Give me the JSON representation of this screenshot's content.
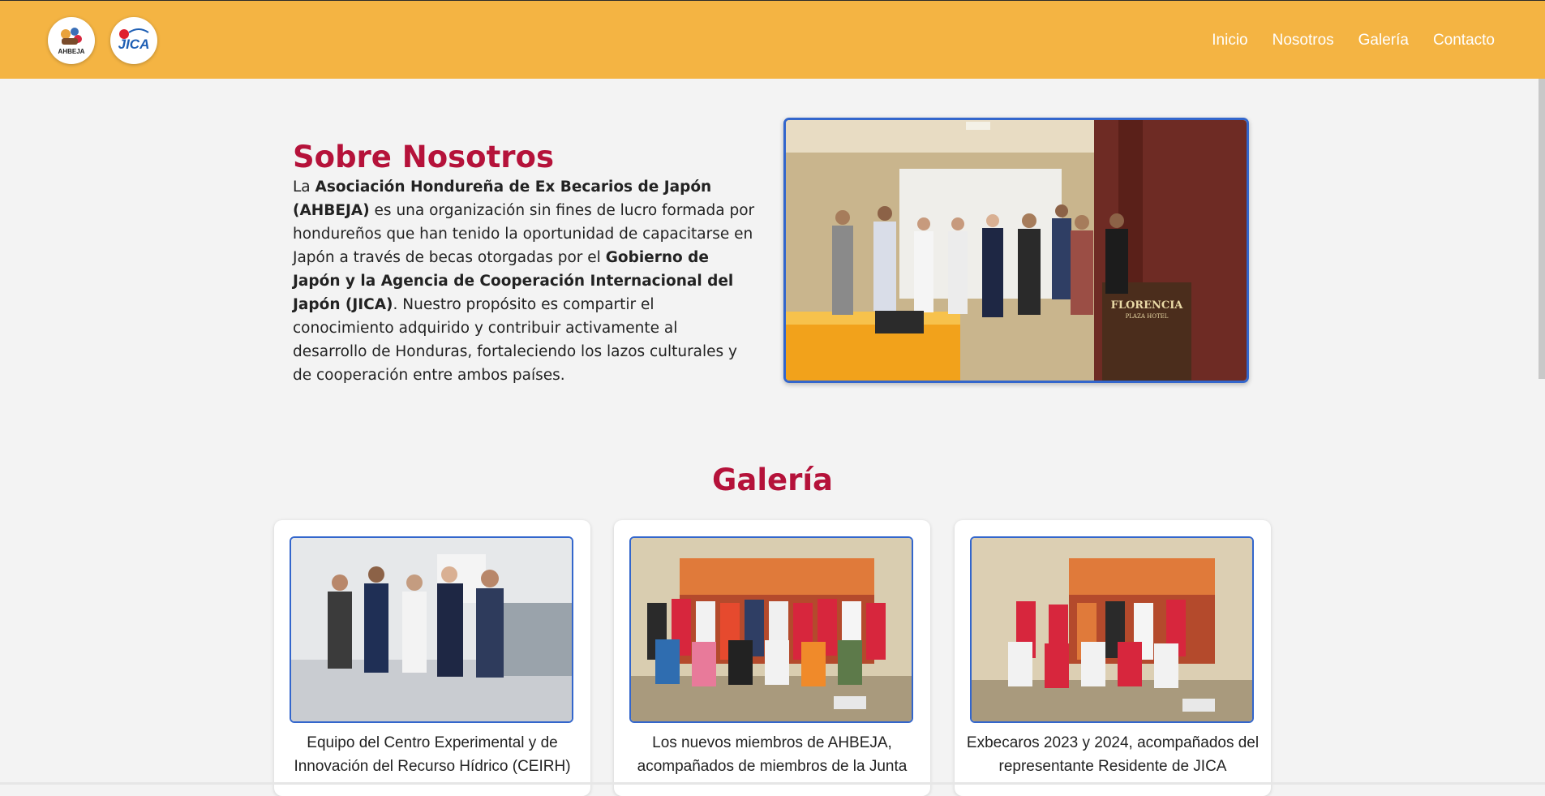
{
  "nav": {
    "logos": [
      {
        "label": "AHBEJA",
        "icon": "ahbeja-logo-icon"
      },
      {
        "label": "JICA",
        "icon": "jica-logo-icon"
      }
    ],
    "links": [
      "Inicio",
      "Nosotros",
      "Galería",
      "Contacto"
    ]
  },
  "about": {
    "title": "Sobre Nosotros",
    "p1": "La ",
    "b1": "Asociación Hondureña de Ex Becarios de Japón (AHBEJA)",
    "p2": " es una organización sin fines de lucro formada por hondureños que han tenido la oportunidad de capacitarse en Japón a través de becas otorgadas por el ",
    "b2": "Gobierno de Japón y la Agencia de Cooperación Internacional del Japón (JICA)",
    "p3": ". Nuestro propósito es compartir el conocimiento adquirido y contribuir activamente al desarrollo de Honduras, fortaleciendo los lazos culturales y de cooperación entre ambos países.",
    "photo_sign_1": "FLORENCIA",
    "photo_sign_2": "PLAZA HOTEL"
  },
  "gallery": {
    "title": "Galería",
    "cards": [
      {
        "caption": "Equipo del Centro Experimental y de Innovación del Recurso Hídrico (CEIRH)"
      },
      {
        "caption": "Los nuevos miembros de AHBEJA, acompañados de miembros de la Junta"
      },
      {
        "caption": "Exbecaros 2023 y 2024, acompañados del representante Residente de JICA"
      }
    ]
  },
  "colors": {
    "navbar": "#f4b443",
    "heading": "#b5123a",
    "photo_border": "#3366cc",
    "background": "#f3f3f3"
  }
}
